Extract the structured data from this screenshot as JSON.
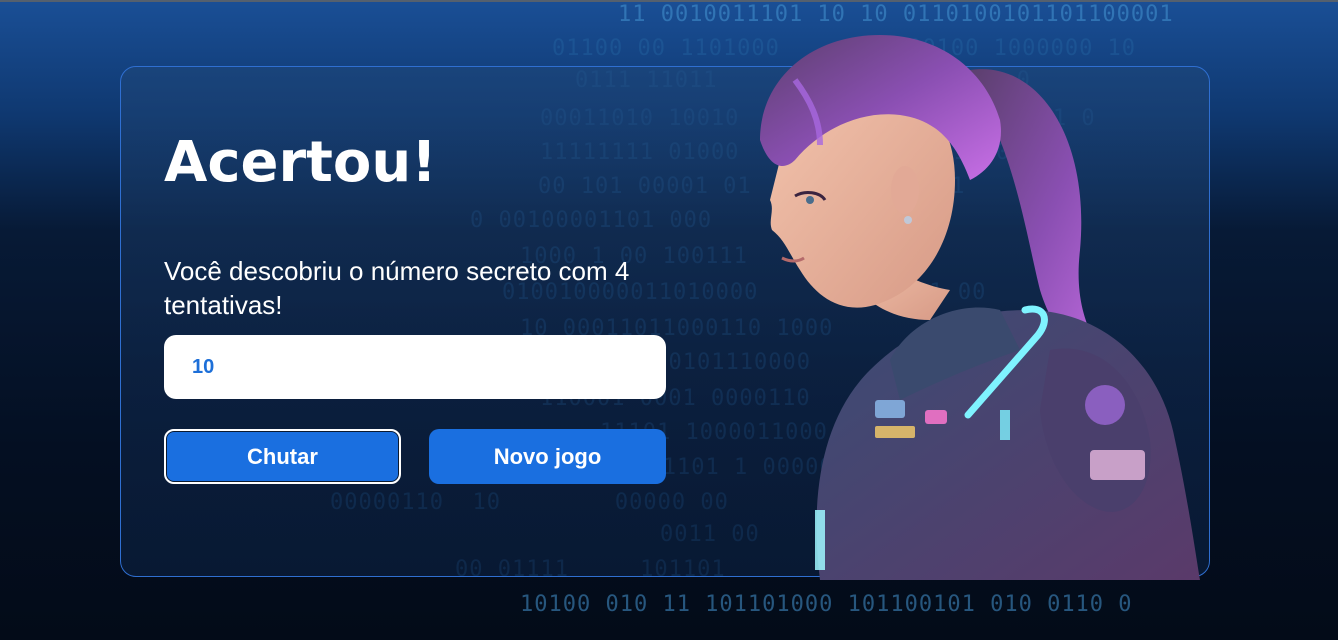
{
  "background_binary": [
    "11 0010011101 10 10 0110100101101100001",
    "01100 00 1101000        100100 1000000 10",
    "0111 11011              0111 1 0",
    "00011010 10010          1110110100001 0",
    "11111111 01000          0000011 0 0",
    "00 101 00001 01         001011",
    "0 00100001101 000       011 10 0",
    "1000 1 00 100111        1101",
    "010010000011010000      0100011 00",
    "10 00011011000110 1000",
    "000101110000",
    "110001 0001 0000110",
    "11101 1000011000",
    "0011101 1 000000",
    "00000110  10        00000 00",
    "0011 00",
    "00 01111     101101",
    "10100 010 11 101101000 101100101 010 0110 0"
  ],
  "card": {
    "title": "Acertou!",
    "message": "Você descobriu o número secreto com 4 tentativas!",
    "input": {
      "value": "10",
      "placeholder": ""
    },
    "buttons": {
      "guess_label": "Chutar",
      "new_game_label": "Novo jogo"
    }
  },
  "illustration": {
    "icon": "cyberpunk-woman-character"
  },
  "colors": {
    "accent": "#1a6fe0",
    "card_border": "#2f6fd1",
    "input_text": "#1d6fd8"
  }
}
